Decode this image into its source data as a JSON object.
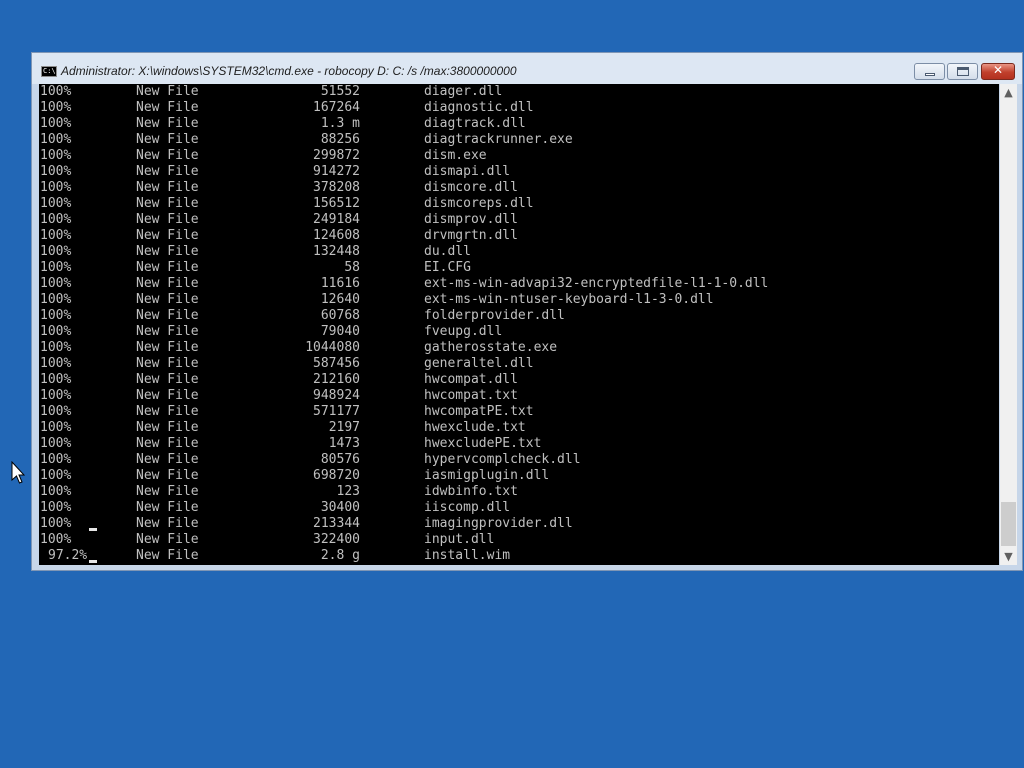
{
  "window": {
    "title": "Administrator: X:\\windows\\SYSTEM32\\cmd.exe - robocopy  D: C: /s /max:3800000000",
    "icon": "cmd-icon",
    "icon_text": "C:\\",
    "close_glyph": "✕"
  },
  "console": {
    "rows": [
      {
        "percent": "100%",
        "type": "New File",
        "size": "51552",
        "name": "diager.dll"
      },
      {
        "percent": "100%",
        "type": "New File",
        "size": "167264",
        "name": "diagnostic.dll"
      },
      {
        "percent": "100%",
        "type": "New File",
        "size": "1.3 m",
        "name": "diagtrack.dll"
      },
      {
        "percent": "100%",
        "type": "New File",
        "size": "88256",
        "name": "diagtrackrunner.exe"
      },
      {
        "percent": "100%",
        "type": "New File",
        "size": "299872",
        "name": "dism.exe"
      },
      {
        "percent": "100%",
        "type": "New File",
        "size": "914272",
        "name": "dismapi.dll"
      },
      {
        "percent": "100%",
        "type": "New File",
        "size": "378208",
        "name": "dismcore.dll"
      },
      {
        "percent": "100%",
        "type": "New File",
        "size": "156512",
        "name": "dismcoreps.dll"
      },
      {
        "percent": "100%",
        "type": "New File",
        "size": "249184",
        "name": "dismprov.dll"
      },
      {
        "percent": "100%",
        "type": "New File",
        "size": "124608",
        "name": "drvmgrtn.dll"
      },
      {
        "percent": "100%",
        "type": "New File",
        "size": "132448",
        "name": "du.dll"
      },
      {
        "percent": "100%",
        "type": "New File",
        "size": "58",
        "name": "EI.CFG"
      },
      {
        "percent": "100%",
        "type": "New File",
        "size": "11616",
        "name": "ext-ms-win-advapi32-encryptedfile-l1-1-0.dll"
      },
      {
        "percent": "100%",
        "type": "New File",
        "size": "12640",
        "name": "ext-ms-win-ntuser-keyboard-l1-3-0.dll"
      },
      {
        "percent": "100%",
        "type": "New File",
        "size": "60768",
        "name": "folderprovider.dll"
      },
      {
        "percent": "100%",
        "type": "New File",
        "size": "79040",
        "name": "fveupg.dll"
      },
      {
        "percent": "100%",
        "type": "New File",
        "size": "1044080",
        "name": "gatherosstate.exe"
      },
      {
        "percent": "100%",
        "type": "New File",
        "size": "587456",
        "name": "generaltel.dll"
      },
      {
        "percent": "100%",
        "type": "New File",
        "size": "212160",
        "name": "hwcompat.dll"
      },
      {
        "percent": "100%",
        "type": "New File",
        "size": "948924",
        "name": "hwcompat.txt"
      },
      {
        "percent": "100%",
        "type": "New File",
        "size": "571177",
        "name": "hwcompatPE.txt"
      },
      {
        "percent": "100%",
        "type": "New File",
        "size": "2197",
        "name": "hwexclude.txt"
      },
      {
        "percent": "100%",
        "type": "New File",
        "size": "1473",
        "name": "hwexcludePE.txt"
      },
      {
        "percent": "100%",
        "type": "New File",
        "size": "80576",
        "name": "hypervcomplcheck.dll"
      },
      {
        "percent": "100%",
        "type": "New File",
        "size": "698720",
        "name": "iasmigplugin.dll"
      },
      {
        "percent": "100%",
        "type": "New File",
        "size": "123",
        "name": "idwbinfo.txt"
      },
      {
        "percent": "100%",
        "type": "New File",
        "size": "30400",
        "name": "iiscomp.dll"
      },
      {
        "percent": "100%",
        "type": "New File",
        "size": "213344",
        "name": "imagingprovider.dll"
      },
      {
        "percent": "100%",
        "type": "New File",
        "size": "322400",
        "name": "input.dll"
      },
      {
        "percent": "97.2%",
        "type": "New File",
        "size": "2.8 g",
        "name": "install.wim"
      }
    ]
  },
  "scrollbar": {
    "up_glyph": "▲",
    "down_glyph": "▼"
  }
}
